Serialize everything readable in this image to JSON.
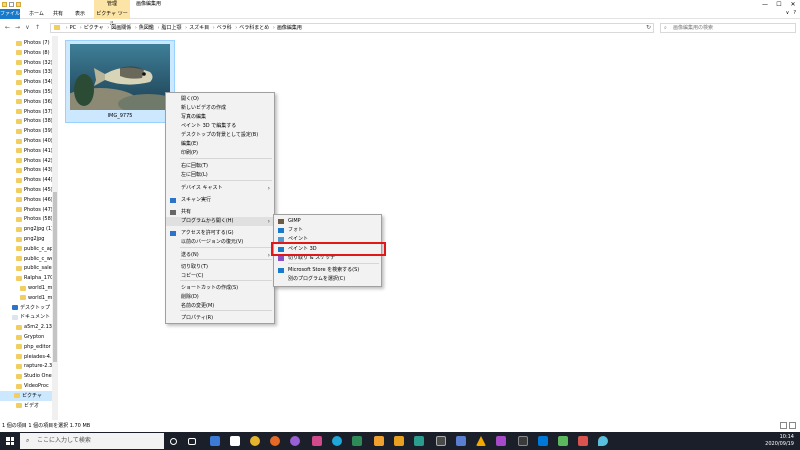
{
  "titlebar": {
    "manage_tab": "管理",
    "title": "画像編集用",
    "controls": [
      "—",
      "☐",
      "✕"
    ]
  },
  "ribbon": {
    "tabs": [
      "ファイル",
      "ホーム",
      "共有",
      "表示",
      "ピクチャ ツール"
    ],
    "right": [
      "∨",
      "?"
    ]
  },
  "address": {
    "back": "←",
    "forward": "→",
    "down": "∨",
    "up": "↑",
    "crumbs": [
      "PC",
      "ピクチャ",
      "図画關係",
      "魚図鑑",
      "脂口上颚",
      "スズキ目",
      "ベラ科",
      "ベラ科まとめ",
      "画像編集用"
    ],
    "refresh": "↻",
    "search_placeholder": "画像編集用の検索",
    "search_icon": "search-icon"
  },
  "nav": {
    "items": [
      "Photos (7)",
      "Photos (8)",
      "Photos (32)",
      "Photos (33)",
      "Photos (34)",
      "Photos (35)",
      "Photos (36)",
      "Photos (37)",
      "Photos (38)",
      "Photos (39)",
      "Photos (40)",
      "Photos (41)",
      "Photos (42)",
      "Photos (43)",
      "Photos (44)",
      "Photos (45)",
      "Photos (46)",
      "Photos (47)",
      "Photos (58)",
      "png2jpg (1)",
      "png2jpg",
      "public_c_ap",
      "public_c_wc",
      "public_sale",
      "Ralpha_170",
      "world1_map",
      "world1_m",
      "デスクトップ",
      "ドキュメント",
      "a5m2_2.13.",
      "Grypton",
      "php_editor",
      "pleiades-4.",
      "rapture-2.3",
      "Studio One",
      "VideoProc",
      "ピクチャ",
      "ビデオ"
    ]
  },
  "file": {
    "name": "IMG_9775"
  },
  "status": {
    "text": "1 個の項目   1 個の項目を選択  1.70 MB"
  },
  "context_menu": {
    "items": [
      "開く(O)",
      "新しいビデオの作成",
      "写真の編集",
      "ペイント 3D で編集する",
      "デスクトップの背景として設定(B)",
      "編集(E)",
      "印刷(P)",
      "右に回転(T)",
      "左に回転(L)",
      "デバイス キャスト",
      "スキャン実行",
      "共有",
      "プログラムから開く(H)",
      "アクセスを許可する(G)",
      "以前のバージョンの復元(V)",
      "送る(N)",
      "切り取り(T)",
      "コピー(C)",
      "ショートカットの作成(S)",
      "削除(D)",
      "名前の変更(M)",
      "プロパティ(R)"
    ],
    "arrow": "›"
  },
  "submenu": {
    "items": [
      "GIMP",
      "フォト",
      "ペイント",
      "ペイント 3D",
      "切り取り & スケッチ",
      "Microsoft Store を検索する(S)",
      "別のプログラムを選択(C)"
    ]
  },
  "taskbar": {
    "search_placeholder": "ここに入力して検索",
    "time": "10:14",
    "date": "2020/09/19"
  },
  "colors": {
    "accent": "#1979ca",
    "selection": "#cce8ff",
    "highlight_box": "#e01818",
    "taskbar": "#1b1f2a"
  }
}
